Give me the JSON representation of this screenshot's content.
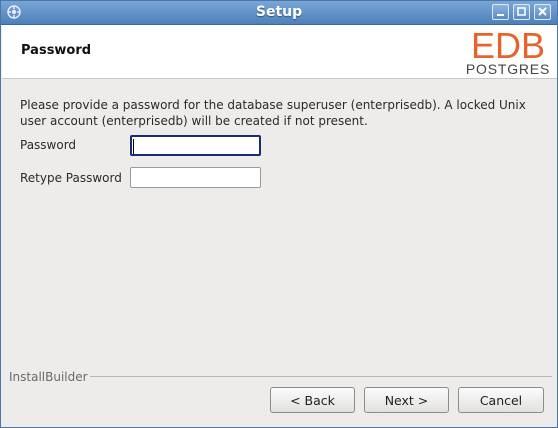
{
  "window": {
    "title": "Setup"
  },
  "header": {
    "title": "Password",
    "logo": {
      "brand": "EDB",
      "product": "POSTGRES",
      "brand_color": "#e8632b"
    }
  },
  "main": {
    "description": "Please provide a password for the database superuser (enterprisedb). A locked Unix user account (enterprisedb) will be created if not present.",
    "password_label": "Password",
    "password_value": "",
    "retype_label": "Retype Password",
    "retype_value": ""
  },
  "footer": {
    "group_label": "InstallBuilder",
    "back_label": "< Back",
    "next_label": "Next >",
    "cancel_label": "Cancel"
  },
  "icons": {
    "app": "installer-icon",
    "minimize": "minimize-icon",
    "maximize": "maximize-icon",
    "close": "close-icon"
  }
}
